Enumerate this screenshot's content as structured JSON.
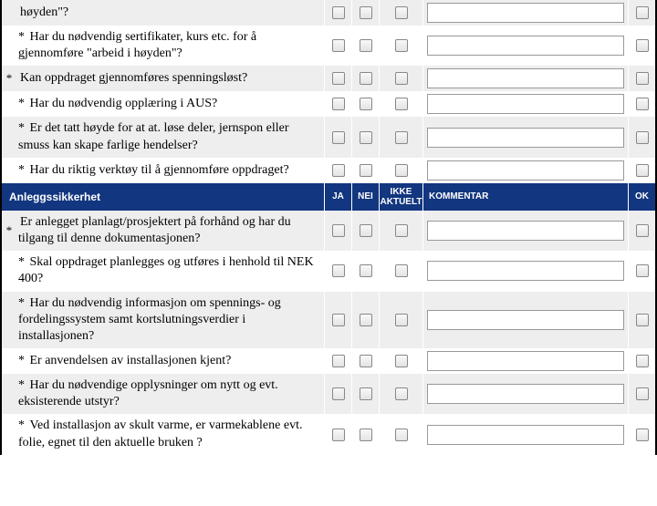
{
  "rows": [
    {
      "type": "q",
      "star_col": "",
      "star_text": "",
      "text": "høyden\"?",
      "alt": true,
      "cb": true,
      "komm": true,
      "ok": true
    },
    {
      "type": "q",
      "star_col": "",
      "star_text": "* ",
      "text": "Har du nødvendig sertifikater, kurs etc. for å gjennomføre \"arbeid i høyden\"?",
      "alt": false,
      "cb": true,
      "komm": true,
      "ok": true
    },
    {
      "type": "q",
      "star_col": "*",
      "star_text": "",
      "text": "Kan oppdraget gjennomføres spenningsløst?",
      "alt": true,
      "cb": true,
      "komm": true,
      "ok": true
    },
    {
      "type": "q",
      "star_col": "",
      "star_text": "* ",
      "text": "Har du nødvendig opplæring i AUS?",
      "alt": false,
      "cb": true,
      "komm": true,
      "ok": true
    },
    {
      "type": "q",
      "star_col": "",
      "star_text": "* ",
      "text": "Er det tatt høyde for at at. løse deler, jernspon eller smuss kan skape farlige hendelser?",
      "alt": true,
      "cb": true,
      "komm": true,
      "ok": true
    },
    {
      "type": "q",
      "star_col": "",
      "star_text": "* ",
      "text": "Har du riktig verktøy til å gjennomføre oppdraget?",
      "alt": false,
      "cb": true,
      "komm": true,
      "ok": true
    },
    {
      "type": "header",
      "title": "Anleggssikkerhet",
      "ja": "JA",
      "nei": "NEI",
      "ikke": "IKKE AKTUELT",
      "komm": "KOMMENTAR",
      "ok": "OK"
    },
    {
      "type": "q",
      "star_col": "*",
      "star_text": "",
      "text": "Er anlegget planlagt/prosjektert på forhånd og har du tilgang til denne dokumentasjonen?",
      "alt": true,
      "cb": true,
      "komm": true,
      "ok": true
    },
    {
      "type": "q",
      "star_col": "",
      "star_text": "* ",
      "text": "Skal oppdraget planlegges og utføres i henhold til NEK 400?",
      "alt": false,
      "cb": true,
      "komm": true,
      "ok": true
    },
    {
      "type": "q",
      "star_col": "",
      "star_text": "* ",
      "text": "Har du nødvendig informasjon om spennings- og fordelingssystem samt kortslutningsverdier i installasjonen?",
      "alt": true,
      "cb": true,
      "komm": true,
      "ok": true
    },
    {
      "type": "q",
      "star_col": "",
      "star_text": "* ",
      "text": "Er anvendelsen av installasjonen kjent?",
      "alt": false,
      "cb": true,
      "komm": true,
      "ok": true
    },
    {
      "type": "q",
      "star_col": "",
      "star_text": "* ",
      "text": "Har du nødvendige opplysninger om nytt og evt. eksisterende utstyr?",
      "alt": true,
      "cb": true,
      "komm": true,
      "ok": true
    },
    {
      "type": "q",
      "star_col": "",
      "star_text": "* ",
      "text": "Ved installasjon av skult varme, er varmekablene evt. folie, egnet til den aktuelle bruken ?",
      "alt": false,
      "cb": true,
      "komm": true,
      "ok": true
    }
  ]
}
